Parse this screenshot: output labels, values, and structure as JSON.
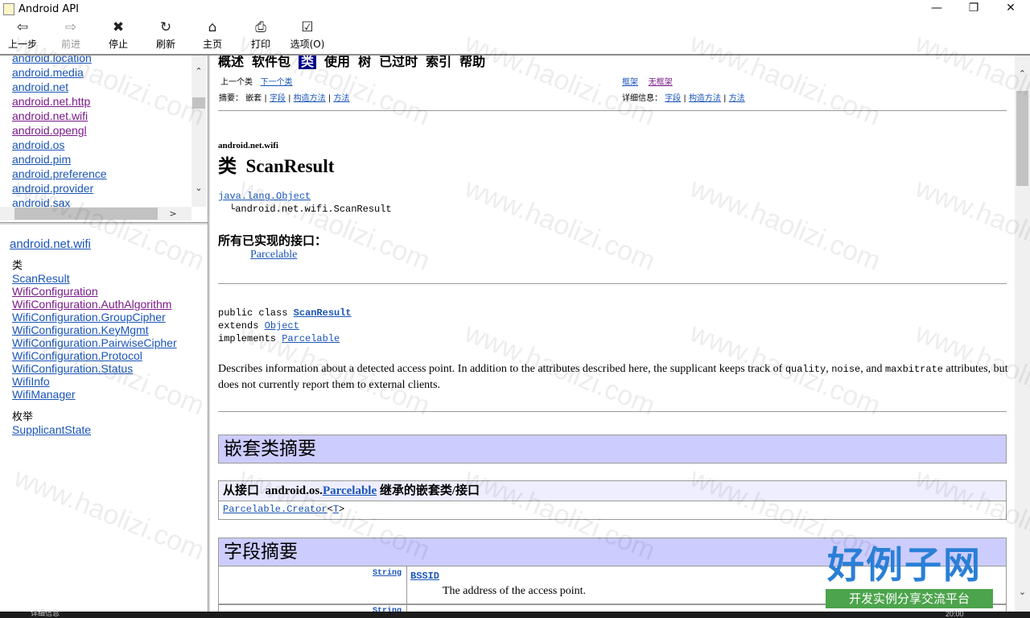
{
  "window": {
    "title": "Android API",
    "minimize": "—",
    "maximize": "❐",
    "close": "✕"
  },
  "toolbar": [
    {
      "label": "上一步",
      "icon": "back-arrow-icon",
      "glyph": "⇦",
      "enabled": true
    },
    {
      "label": "前进",
      "icon": "forward-arrow-icon",
      "glyph": "⇨",
      "enabled": false
    },
    {
      "label": "停止",
      "icon": "stop-icon",
      "glyph": "✖",
      "enabled": true
    },
    {
      "label": "刷新",
      "icon": "refresh-icon",
      "glyph": "↻",
      "enabled": true
    },
    {
      "label": "主页",
      "icon": "home-icon",
      "glyph": "⌂",
      "enabled": true
    },
    {
      "label": "打印",
      "icon": "print-icon",
      "glyph": "⎙",
      "enabled": true
    },
    {
      "label": "选项(O)",
      "icon": "options-icon",
      "glyph": "☑",
      "enabled": true
    }
  ],
  "packages": [
    "android.location",
    "android.media",
    "android.net",
    "android.net.http",
    "android.net.wifi",
    "android.opengl",
    "android.os",
    "android.pim",
    "android.preference",
    "android.provider",
    "android.sax"
  ],
  "visited_packages": [
    "android.net.http",
    "android.net.wifi",
    "android.opengl"
  ],
  "package_frame": {
    "package_name": "android.net.wifi",
    "classes_heading": "类",
    "classes": [
      "ScanResult",
      "WifiConfiguration",
      "WifiConfiguration.AuthAlgorithm",
      "WifiConfiguration.GroupCipher",
      "WifiConfiguration.KeyMgmt",
      "WifiConfiguration.PairwiseCipher",
      "WifiConfiguration.Protocol",
      "WifiConfiguration.Status",
      "WifiInfo",
      "WifiManager"
    ],
    "visited_classes": [
      "WifiConfiguration",
      "WifiConfiguration.AuthAlgorithm"
    ],
    "enums_heading": "枚举",
    "enums": [
      "SupplicantState"
    ]
  },
  "doc": {
    "nav": {
      "overview": "概述",
      "package": "软件包",
      "class": "类",
      "use": "使用",
      "tree": "树",
      "deprecated": "已过时",
      "index": "索引",
      "help": "帮助"
    },
    "prev_class": "上一个类",
    "next_class": "下一个类",
    "frames": "框架",
    "no_frames": "无框架",
    "summary_label": "摘要：",
    "nested": "嵌套",
    "field": "字段",
    "constructor": "构造方法",
    "method": "方法",
    "detail_label": "详细信息：",
    "sep": "|",
    "package_name": "android.net.wifi",
    "class_prefix": "类",
    "class_name": "ScanResult",
    "hier_parent": "java.lang.Object",
    "hier_child": "android.net.wifi.ScanResult",
    "hier_branch": "└",
    "impl_heading": "所有已实现的接口：",
    "impl_iface": "Parcelable",
    "decl_public": "public class",
    "decl_class": "ScanResult",
    "decl_extends": "extends",
    "decl_object": "Object",
    "decl_implements": "implements",
    "decl_iface": "Parcelable",
    "desc_1": "Describes information about a detected access point. In addition to the attributes described here, the supplicant keeps track of",
    "desc_quality": "quality",
    "desc_comma1": ",",
    "desc_noise": "noise",
    "desc_and": ", and",
    "desc_maxbitrate": "maxbitrate",
    "desc_2": "attributes, but does not currently report them to external clients.",
    "nested_summary": "嵌套类摘要",
    "inherit_from": "从接口",
    "inherit_pkg": "android.os.",
    "inherit_iface": "Parcelable",
    "inherit_suffix": "继承的嵌套类/接口",
    "inherit_item": "Parcelable.Creator",
    "inherit_lt": "<",
    "inherit_T": "T",
    "inherit_gt": ">",
    "field_summary": "字段摘要",
    "field_type": "String",
    "field_name": "BSSID",
    "field_desc": "The address of the access point.",
    "field_type2": "String"
  },
  "brand": {
    "title": "好例子网",
    "subtitle": "开发实例分享交流平台"
  },
  "watermark": "www.haolizi.com",
  "status": {
    "left": "详细信息",
    "right": "20:00"
  }
}
